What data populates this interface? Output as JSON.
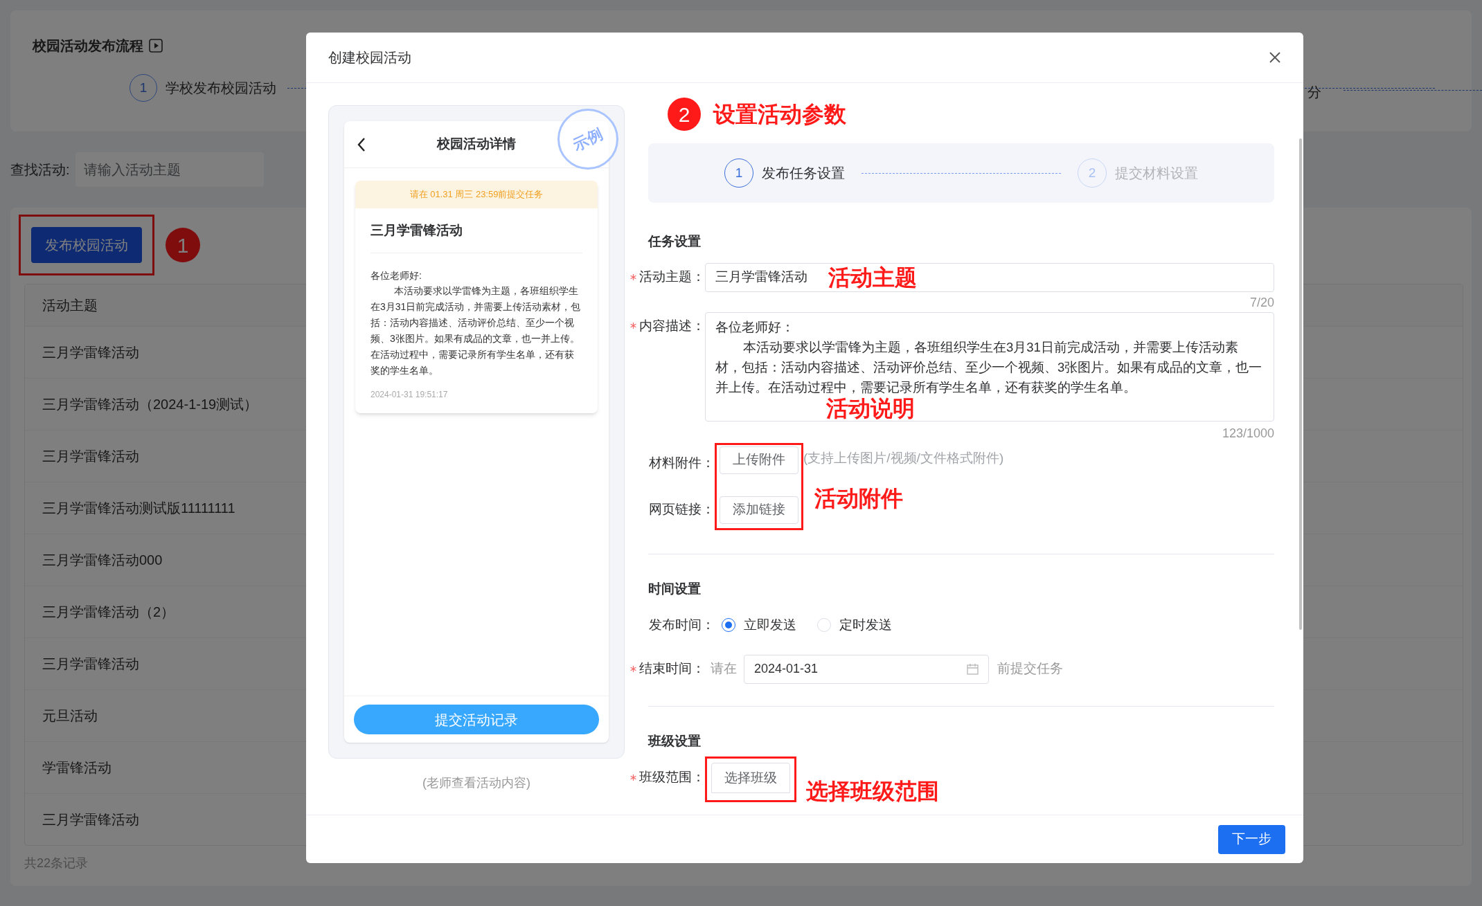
{
  "background_page": {
    "process_card": {
      "title": "校园活动发布流程",
      "step_number": "1",
      "step_label": "学校发布校园活动",
      "cut_step_label": "分"
    },
    "search": {
      "label": "查找活动:",
      "placeholder": "请输入活动主题"
    },
    "publish_button": "发布校园活动",
    "publish_marker": "1",
    "table": {
      "columns": [
        "活动主题"
      ],
      "rows": [
        {
          "title": "三月学雷锋活动"
        },
        {
          "title": "三月学雷锋活动（2024-1-19测试）"
        },
        {
          "title": "三月学雷锋活动"
        },
        {
          "title": "三月学雷锋活动测试版11111111"
        },
        {
          "title": "三月学雷锋活动000"
        },
        {
          "title": "三月学雷锋活动（2）"
        },
        {
          "title": "三月学雷锋活动"
        },
        {
          "title": "元旦活动"
        },
        {
          "title": "学雷锋活动"
        },
        {
          "title": "三月学雷锋活动"
        }
      ]
    },
    "record_count": "共22条记录"
  },
  "dialog": {
    "title": "创建校园活动",
    "preview": {
      "stamp": "示例",
      "header": "校园活动详情",
      "deadline_notice": "请在 01.31 周三 23:59前提交任务",
      "activity_title": "三月学雷锋活动",
      "greeting": "各位老师好:",
      "body": "本活动要求以学雷锋为主题，各班组织学生在3月31日前完成活动，并需要上传活动素材，包括：活动内容描述、活动评价总结、至少一个视频、3张图片。如果有成品的文章，也一并上传。在活动过程中，需要记录所有学生名单，还有获奖的学生名单。",
      "timestamp": "2024-01-31 19:51:17",
      "submit_button": "提交活动记录",
      "caption": "(老师查看活动内容)"
    },
    "step_marker": "2",
    "step_annotation": "设置活动参数",
    "steps": [
      {
        "number": "1",
        "label": "发布任务设置",
        "selected": true
      },
      {
        "number": "2",
        "label": "提交材料设置",
        "selected": false
      }
    ],
    "task_section": {
      "heading": "任务设置",
      "topic": {
        "label": "活动主题：",
        "required": true,
        "value": "三月学雷锋活动",
        "annotation": "活动主题",
        "counter": "7/20"
      },
      "description": {
        "label": "内容描述：",
        "required": true,
        "greeting": "各位老师好：",
        "value": "本活动要求以学雷锋为主题，各班组织学生在3月31日前完成活动，并需要上传活动素材，包括：活动内容描述、活动评价总结、至少一个视频、3张图片。如果有成品的文章，也一并上传。在活动过程中，需要记录所有学生名单，还有获奖的学生名单。",
        "annotation": "活动说明",
        "counter": "123/1000"
      },
      "attachment": {
        "label": "材料附件：",
        "button": "上传附件",
        "hint": "(支持上传图片/视频/文件格式附件)"
      },
      "link": {
        "label": "网页链接：",
        "button": "添加链接"
      },
      "attachments_annotation": "活动附件"
    },
    "time_section": {
      "heading": "时间设置",
      "publish_label": "发布时间：",
      "options": [
        {
          "label": "立即发送",
          "selected": true
        },
        {
          "label": "定时发送",
          "selected": false
        }
      ],
      "end_label": "结束时间：",
      "end_required": true,
      "prefix": "请在",
      "date": "2024-01-31",
      "suffix": "前提交任务"
    },
    "class_section": {
      "heading": "班级设置",
      "label": "班级范围：",
      "required": true,
      "button": "选择班级",
      "annotation": "选择班级范围"
    },
    "next_button": "下一步"
  }
}
